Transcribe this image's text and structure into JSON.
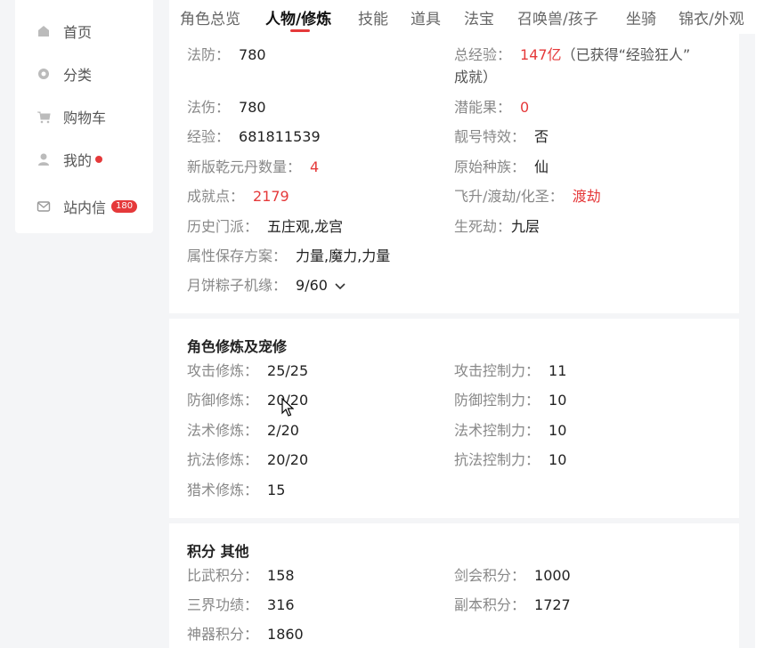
{
  "sidebar": {
    "items": [
      {
        "label": "首页",
        "icon": "home-icon"
      },
      {
        "label": "分类",
        "icon": "category-icon"
      },
      {
        "label": "购物车",
        "icon": "cart-icon"
      },
      {
        "label": "我的",
        "icon": "user-icon"
      },
      {
        "label": "站内信",
        "icon": "mail-icon",
        "badge": "180"
      }
    ]
  },
  "tabs": [
    "角色总览",
    "人物/修炼",
    "技能",
    "道具",
    "法宝",
    "召唤兽/孩子",
    "坐骑",
    "锦衣/外观"
  ],
  "active_tab": "人物/修炼",
  "character": {
    "fafang": {
      "label": "法防：",
      "value": "780"
    },
    "zongjingyan": {
      "label": "总经验：",
      "value": "147亿",
      "extra": "（已获得“经验狂人”",
      "extra2": "成就）"
    },
    "fashang": {
      "label": "法伤：",
      "value": "780"
    },
    "qiannengguo": {
      "label": "潜能果：",
      "value": "0"
    },
    "jingyan": {
      "label": "经验：",
      "value": "681811539"
    },
    "lianghao": {
      "label": "靓号特效：",
      "value": "否"
    },
    "qianyuandan": {
      "label": "新版乾元丹数量：",
      "value": "4"
    },
    "zhongzu": {
      "label": "原始种族：",
      "value": "仙"
    },
    "chengjiu": {
      "label": "成就点：",
      "value": "2179"
    },
    "feisheng": {
      "label": "飞升/渡劫/化圣：",
      "value": "渡劫"
    },
    "menpai": {
      "label": "历史门派：",
      "value": "五庄观,龙宫"
    },
    "shengsijie": {
      "label": "生死劫：",
      "value": "九层"
    },
    "shuxing": {
      "label": "属性保存方案：",
      "value": "力量,魔力,力量"
    },
    "yuebing": {
      "label": "月饼粽子机缘：",
      "value": "9/60"
    }
  },
  "cultivation": {
    "title": "角色修炼及宠修",
    "left": [
      {
        "label": "攻击修炼：",
        "value": "25/25"
      },
      {
        "label": "防御修炼：",
        "value": "20/20"
      },
      {
        "label": "法术修炼：",
        "value": "2/20"
      },
      {
        "label": "抗法修炼：",
        "value": "20/20"
      },
      {
        "label": "猎术修炼：",
        "value": "15"
      }
    ],
    "right": [
      {
        "label": "攻击控制力：",
        "value": "11"
      },
      {
        "label": "防御控制力：",
        "value": "10"
      },
      {
        "label": "法术控制力：",
        "value": "10"
      },
      {
        "label": "抗法控制力：",
        "value": "10"
      }
    ]
  },
  "points": {
    "title": "积分 其他",
    "left": [
      {
        "label": "比武积分：",
        "value": "158"
      },
      {
        "label": "三界功绩：",
        "value": "316"
      },
      {
        "label": "神器积分：",
        "value": "1860"
      }
    ],
    "right": [
      {
        "label": "剑会积分：",
        "value": "1000"
      },
      {
        "label": "副本积分：",
        "value": "1727"
      }
    ]
  },
  "colors": {
    "accent": "#e5393a"
  }
}
